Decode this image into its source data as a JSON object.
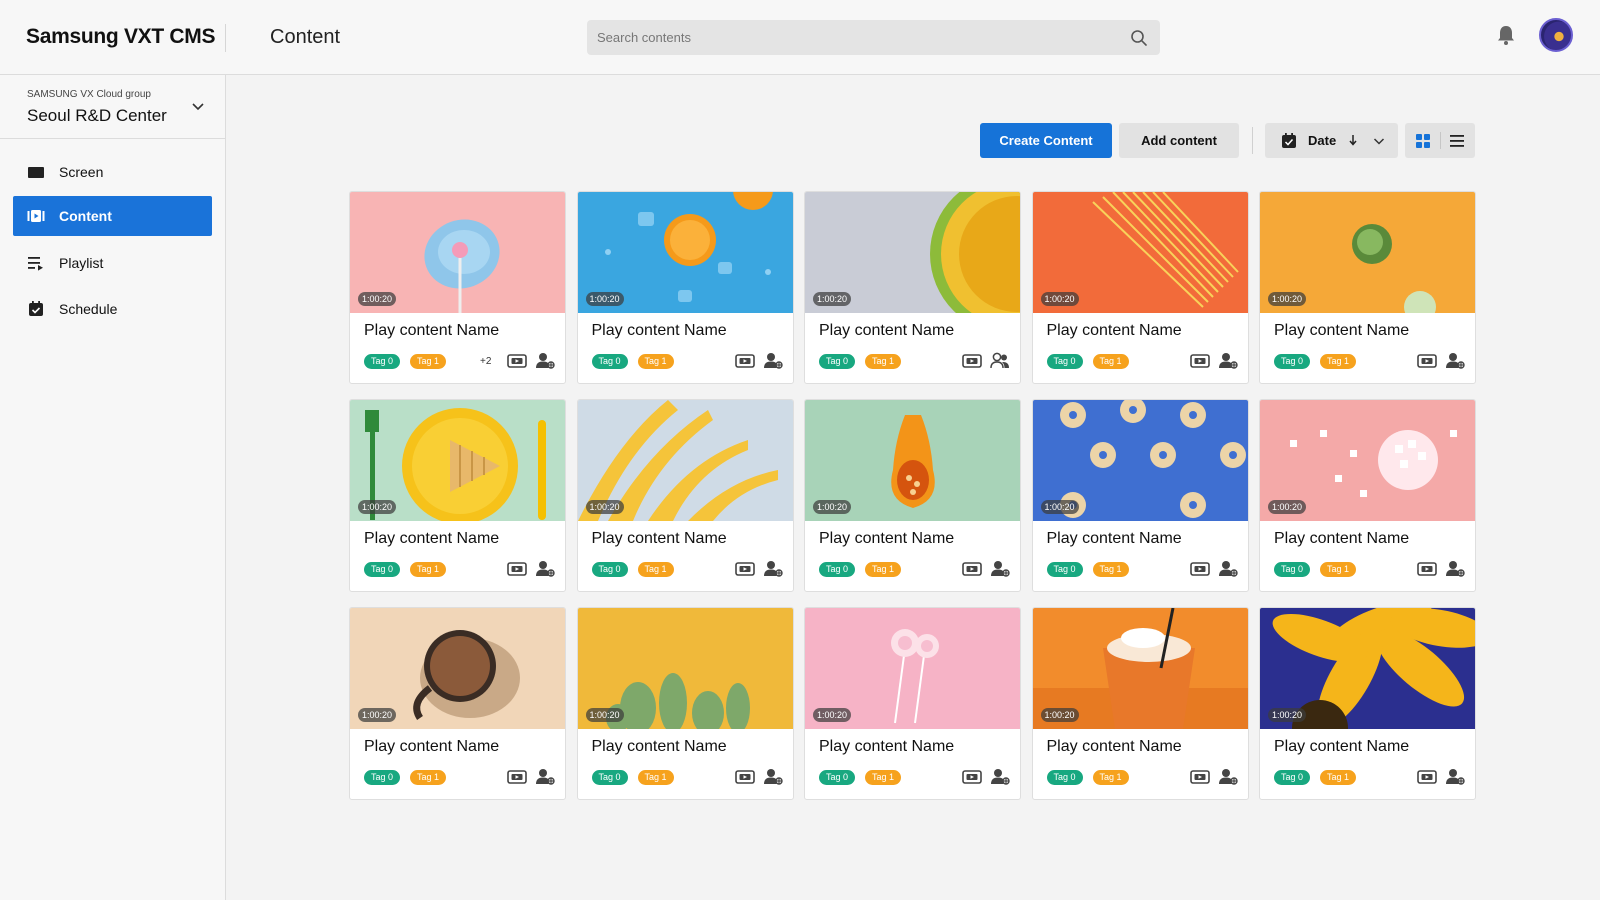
{
  "app": {
    "brand": "Samsung VXT CMS",
    "page_title": "Content"
  },
  "search": {
    "placeholder": "Search contents"
  },
  "sidebar": {
    "group_sub": "SAMSUNG VX Cloud group",
    "group_name": "Seoul R&D Center",
    "items": [
      {
        "label": "Screen",
        "icon": "monitor-icon",
        "active": false
      },
      {
        "label": "Content",
        "icon": "content-icon",
        "active": true
      },
      {
        "label": "Playlist",
        "icon": "playlist-icon",
        "active": false
      },
      {
        "label": "Schedule",
        "icon": "calendar-check-icon",
        "active": false
      }
    ]
  },
  "toolbar": {
    "create_label": "Create Content",
    "add_label": "Add content",
    "sort_label": "Date",
    "sort_direction": "descending",
    "view_mode": "grid"
  },
  "colors": {
    "primary": "#1673d8",
    "tag0": "#18a880",
    "tag1": "#f6a21d"
  },
  "cards": [
    {
      "title": "Play content Name",
      "duration": "1:00:20",
      "tags": [
        "Tag 0",
        "Tag 1"
      ],
      "more": "+2",
      "share": "single",
      "thumb": "lollipop-plate",
      "bg": "#f8b4b4"
    },
    {
      "title": "Play content Name",
      "duration": "1:00:20",
      "tags": [
        "Tag 0",
        "Tag 1"
      ],
      "more": "",
      "share": "single",
      "thumb": "orange-ice",
      "bg": "#3aa6e0"
    },
    {
      "title": "Play content Name",
      "duration": "1:00:20",
      "tags": [
        "Tag 0",
        "Tag 1"
      ],
      "more": "",
      "share": "group",
      "thumb": "melon",
      "bg": "#c9ccd6"
    },
    {
      "title": "Play content Name",
      "duration": "1:00:20",
      "tags": [
        "Tag 0",
        "Tag 1"
      ],
      "more": "",
      "share": "single",
      "thumb": "spaghetti",
      "bg": "#f26b3a"
    },
    {
      "title": "Play content Name",
      "duration": "1:00:20",
      "tags": [
        "Tag 0",
        "Tag 1"
      ],
      "more": "",
      "share": "single",
      "thumb": "sprouts",
      "bg": "#f5a838"
    },
    {
      "title": "Play content Name",
      "duration": "1:00:20",
      "tags": [
        "Tag 0",
        "Tag 1"
      ],
      "more": "",
      "share": "single",
      "thumb": "waffle-plate",
      "bg": "#b9dfc8"
    },
    {
      "title": "Play content Name",
      "duration": "1:00:20",
      "tags": [
        "Tag 0",
        "Tag 1"
      ],
      "more": "",
      "share": "single",
      "thumb": "palm-leaves",
      "bg": "#cfdbe6"
    },
    {
      "title": "Play content Name",
      "duration": "1:00:20",
      "tags": [
        "Tag 0",
        "Tag 1"
      ],
      "more": "",
      "share": "single",
      "thumb": "squash",
      "bg": "#a8d3b8"
    },
    {
      "title": "Play content Name",
      "duration": "1:00:20",
      "tags": [
        "Tag 0",
        "Tag 1"
      ],
      "more": "",
      "share": "single",
      "thumb": "donuts",
      "bg": "#3f6fd1"
    },
    {
      "title": "Play content Name",
      "duration": "1:00:20",
      "tags": [
        "Tag 0",
        "Tag 1"
      ],
      "more": "",
      "share": "single",
      "thumb": "marshmallows",
      "bg": "#f4a9a8"
    },
    {
      "title": "Play content Name",
      "duration": "1:00:20",
      "tags": [
        "Tag 0",
        "Tag 1"
      ],
      "more": "",
      "share": "single",
      "thumb": "coffee",
      "bg": "#f1d6b8"
    },
    {
      "title": "Play content Name",
      "duration": "1:00:20",
      "tags": [
        "Tag 0",
        "Tag 1"
      ],
      "more": "",
      "share": "single",
      "thumb": "cactus",
      "bg": "#f0b93a"
    },
    {
      "title": "Play content Name",
      "duration": "1:00:20",
      "tags": [
        "Tag 0",
        "Tag 1"
      ],
      "more": "",
      "share": "single",
      "thumb": "lollipops",
      "bg": "#f6b3c6"
    },
    {
      "title": "Play content Name",
      "duration": "1:00:20",
      "tags": [
        "Tag 0",
        "Tag 1"
      ],
      "more": "",
      "share": "single",
      "thumb": "milkshake",
      "bg": "#f28c2c"
    },
    {
      "title": "Play content Name",
      "duration": "1:00:20",
      "tags": [
        "Tag 0",
        "Tag 1"
      ],
      "more": "",
      "share": "single",
      "thumb": "sunflower",
      "bg": "#2b2f8f"
    }
  ]
}
